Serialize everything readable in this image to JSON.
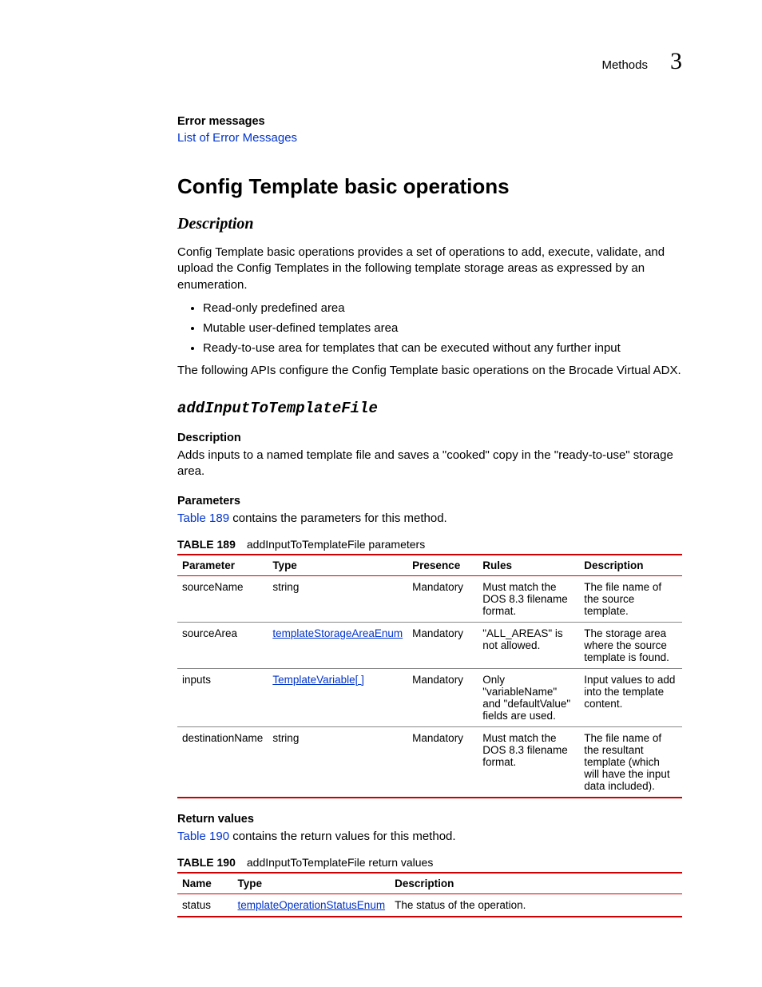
{
  "header": {
    "label": "Methods",
    "chapter": "3"
  },
  "errSection": {
    "title": "Error messages",
    "link": "List of Error Messages"
  },
  "section": {
    "title": "Config Template basic operations"
  },
  "description": {
    "heading": "Description",
    "para1": "Config Template basic operations provides a set of operations to add, execute, validate, and upload the Config Templates in the following template storage areas as expressed by an enumeration.",
    "bullets": [
      "Read-only predefined area",
      "Mutable user-defined templates area",
      "Ready-to-use area for templates that can be executed without any further input"
    ],
    "para2": "The following APIs configure the Config Template basic operations on the Brocade Virtual ADX."
  },
  "method": {
    "name": "addInputToTemplateFile",
    "descHead": "Description",
    "descText": "Adds inputs to a named template file and saves a \"cooked\" copy in the \"ready-to-use\" storage area.",
    "paramsHead": "Parameters",
    "paramsIntroLink": "Table 189",
    "paramsIntroRest": " contains the parameters for this method.",
    "table1": {
      "labelBold": "TABLE 189",
      "labelRest": "addInputToTemplateFile parameters",
      "headers": [
        "Parameter",
        "Type",
        "Presence",
        "Rules",
        "Description"
      ],
      "rows": [
        {
          "param": "sourceName",
          "type": "string",
          "typeLink": false,
          "presence": "Mandatory",
          "rules": "Must match the DOS 8.3 filename format.",
          "desc": "The file name of the source template."
        },
        {
          "param": "sourceArea",
          "type": "templateStorageAreaEnum",
          "typeLink": true,
          "presence": "Mandatory",
          "rules": "\"ALL_AREAS\" is not allowed.",
          "desc": "The storage area where the source template is found."
        },
        {
          "param": "inputs",
          "type": "TemplateVariable[ ]",
          "typeLink": true,
          "presence": "Mandatory",
          "rules": "Only \"variableName\" and \"defaultValue\" fields are used.",
          "desc": "Input values to add into the template content."
        },
        {
          "param": "destinationName",
          "type": "string",
          "typeLink": false,
          "presence": "Mandatory",
          "rules": "Must match the DOS 8.3 filename format.",
          "desc": "The file name of the resultant template (which will have the input data included)."
        }
      ]
    },
    "returnHead": "Return values",
    "returnIntroLink": "Table 190",
    "returnIntroRest": " contains the return values for this method.",
    "table2": {
      "labelBold": "TABLE 190",
      "labelRest": "addInputToTemplateFile return values",
      "headers": [
        "Name",
        "Type",
        "Description"
      ],
      "rows": [
        {
          "name": "status",
          "type": "templateOperationStatusEnum",
          "typeLink": true,
          "desc": "The status of the operation."
        }
      ]
    }
  }
}
